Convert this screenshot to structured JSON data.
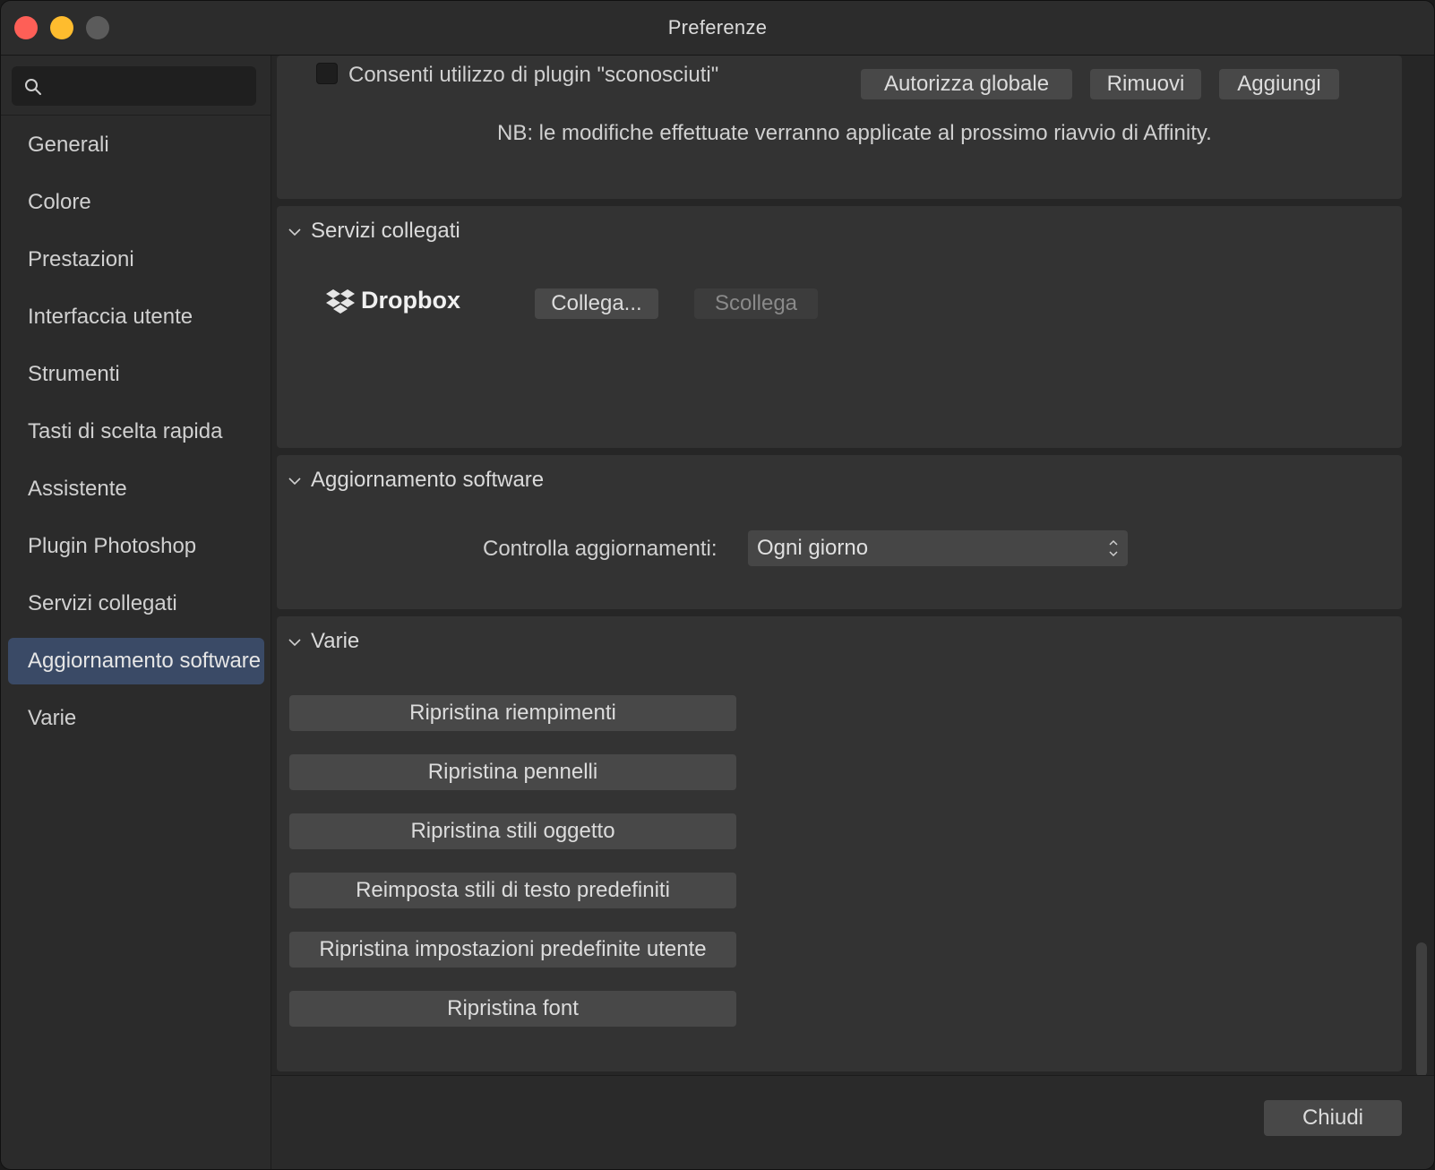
{
  "window": {
    "title": "Preferenze"
  },
  "sidebar": {
    "search": {
      "value": "",
      "placeholder": ""
    },
    "items": [
      {
        "label": "Generali"
      },
      {
        "label": "Colore"
      },
      {
        "label": "Prestazioni"
      },
      {
        "label": "Interfaccia utente"
      },
      {
        "label": "Strumenti"
      },
      {
        "label": "Tasti di scelta rapida"
      },
      {
        "label": "Assistente"
      },
      {
        "label": "Plugin Photoshop"
      },
      {
        "label": "Servizi collegati"
      },
      {
        "label": "Aggiornamento software",
        "selected": true
      },
      {
        "label": "Varie"
      }
    ]
  },
  "plugins": {
    "allow_unknown_label": "Consenti utilizzo di plugin \"sconosciuti\"",
    "allow_unknown_checked": false,
    "authorize_global_label": "Autorizza globale",
    "remove_label": "Rimuovi",
    "add_label": "Aggiungi",
    "note": "NB: le modifiche effettuate verranno applicate al prossimo riavvio di Affinity."
  },
  "linked_services": {
    "title": "Servizi collegati",
    "dropbox_label": "Dropbox",
    "connect_label": "Collega...",
    "disconnect_label": "Scollega"
  },
  "software_update": {
    "title": "Aggiornamento software",
    "check_label": "Controlla aggiornamenti:",
    "check_value": "Ogni giorno"
  },
  "misc": {
    "title": "Varie",
    "buttons": [
      {
        "label": "Ripristina riempimenti"
      },
      {
        "label": "Ripristina pennelli"
      },
      {
        "label": "Ripristina stili oggetto"
      },
      {
        "label": "Reimposta stili di testo predefiniti"
      },
      {
        "label": "Ripristina impostazioni predefinite utente"
      },
      {
        "label": "Ripristina font"
      }
    ]
  },
  "footer": {
    "close_label": "Chiudi"
  },
  "colors": {
    "accent_selected": "#3a4a66",
    "close": "#fe5f57",
    "minimize": "#febc2e"
  }
}
